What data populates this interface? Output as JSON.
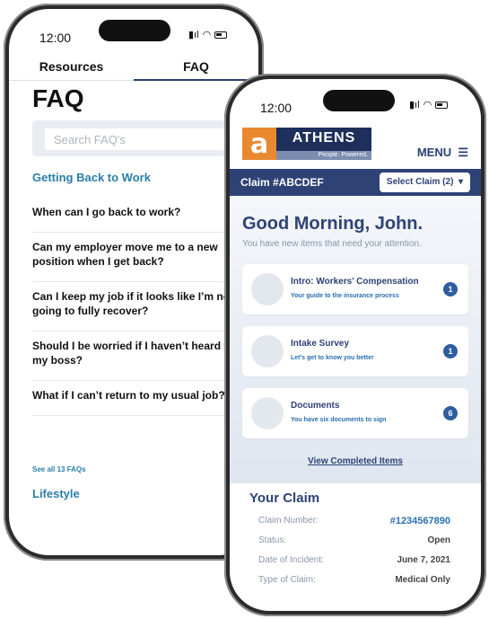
{
  "faq_phone": {
    "status": {
      "time": "12:00"
    },
    "tabs": [
      {
        "label": "Resources"
      },
      {
        "label": "FAQ"
      }
    ],
    "title": "FAQ",
    "search": {
      "placeholder": "Search FAQ's"
    },
    "section_back_to_work": "Getting Back to Work",
    "items": [
      {
        "text": "When can I go back to work?"
      },
      {
        "text": "Can my employer move me to a new position when I get back?"
      },
      {
        "text": "Can I keep my job if it looks like I’m never going to fully recover?"
      },
      {
        "text": "Should I be worried if I haven’t heard from my boss?"
      },
      {
        "text": "What if I can’t return to my usual job?"
      }
    ],
    "see_all": "See all 13 FAQs",
    "section_lifestyle": "Lifestyle"
  },
  "claim_phone": {
    "status": {
      "time": "12:00"
    },
    "logo": {
      "name": "ATHENS",
      "tagline": "People. Powered."
    },
    "menu_label": "MENU",
    "claim_bar": {
      "title": "Claim #ABCDEF",
      "select_label": "Select Claim (2)"
    },
    "greeting": "Good Morning, John.",
    "subgreeting": "You have new items that need your attention.",
    "tasks": [
      {
        "title": "Intro: Workers’ Compensation",
        "subtitle": "Your guide to the insurance process",
        "count": "1"
      },
      {
        "title": "Intake Survey",
        "subtitle": "Let’s get to know you better",
        "count": "1"
      },
      {
        "title": "Documents",
        "subtitle": "You have six documents to sign",
        "count": "6"
      }
    ],
    "view_completed": "View Completed Items",
    "your_claim": {
      "title": "Your Claim",
      "rows": [
        {
          "label": "Claim Number:",
          "value": "#1234567890"
        },
        {
          "label": "Status:",
          "value": "Open"
        },
        {
          "label": "Date of Incident:",
          "value": "June 7, 2021"
        },
        {
          "label": "Type of Claim:",
          "value": "Medical Only"
        }
      ]
    }
  },
  "colors": {
    "brand_navy": "#2e4276",
    "brand_orange": "#e8892f",
    "link_blue": "#2a7fa8"
  }
}
